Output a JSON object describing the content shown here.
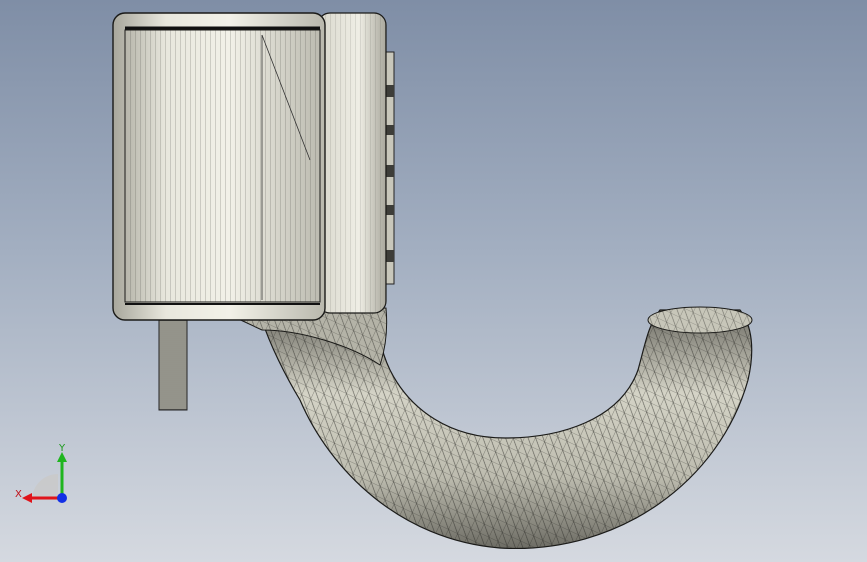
{
  "window": {
    "title": ""
  },
  "viewport": {
    "background_top": "#7f8ea6",
    "background_bottom": "#d5d9e0",
    "model": {
      "description_icon": "crane-hook-icon",
      "body_color": "#c9c8bd",
      "edge_color": "#1c1c1c"
    }
  },
  "triad": {
    "x_label": "X",
    "y_label": "Y",
    "x_color": "#e0141b",
    "y_color": "#1fb51f",
    "z_color": "#1230e6"
  }
}
